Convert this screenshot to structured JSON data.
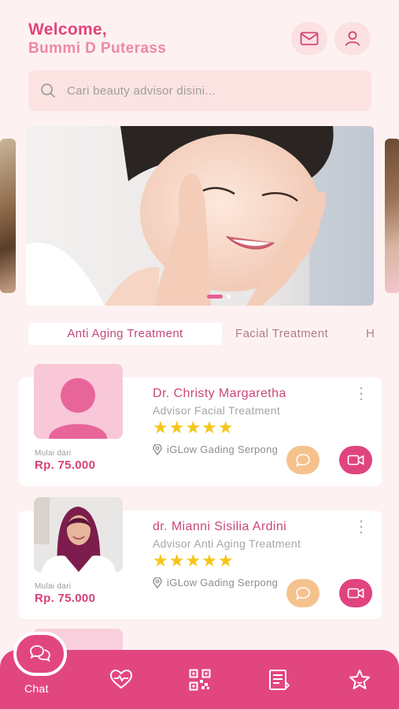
{
  "header": {
    "welcome": "Welcome,",
    "username": "Bummi D Puterass",
    "icons": [
      "mail-icon",
      "user-icon"
    ]
  },
  "search": {
    "placeholder": "Cari beauty advisor disini..."
  },
  "carousel": {
    "slides": 3,
    "active_index": 0
  },
  "tabs": [
    {
      "label": "Anti Aging Treatment",
      "active": true
    },
    {
      "label": "Facial Treatment",
      "active": false
    },
    {
      "label": "H",
      "active": false
    }
  ],
  "advisors": [
    {
      "name": "Dr. Christy Margaretha",
      "role": "Advisor Facial Treatment",
      "stars": "★★★★★",
      "rating": 5,
      "location": "iGLow Gading Serpong",
      "price_label": "Mulai dari",
      "price": "Rp. 75.000",
      "avatar": "placeholder"
    },
    {
      "name": "dr. Mianni Sisilia Ardini",
      "role": "Advisor Anti Aging Treatment",
      "stars": "★★★★★",
      "rating": 5,
      "location": "iGLow Gading Serpong",
      "price_label": "Mulai dari",
      "price": "Rp. 75.000",
      "avatar": "photo"
    }
  ],
  "bottom_nav": {
    "active_label": "Chat",
    "items": [
      "chat-icon",
      "heart-pulse-icon",
      "qr-code-icon",
      "document-icon",
      "star-icon"
    ]
  },
  "colors": {
    "primary": "#e2467f",
    "background": "#fdf2f1",
    "star": "#f5c518",
    "chat_button": "#f5c28e"
  }
}
